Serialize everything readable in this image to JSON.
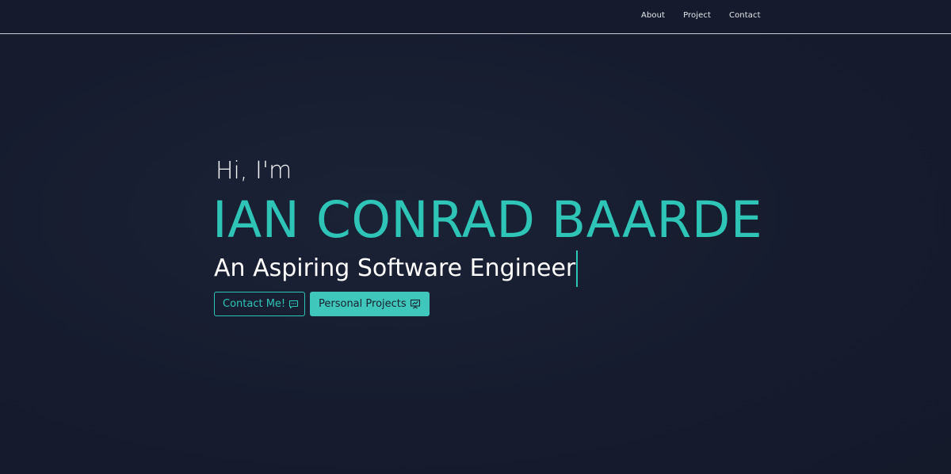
{
  "nav": {
    "items": [
      {
        "label": "About"
      },
      {
        "label": "Project"
      },
      {
        "label": "Contact"
      }
    ]
  },
  "hero": {
    "greeting": "Hi, I'm",
    "name": "IAN CONRAD BAARDE",
    "tagline": "An Aspiring Software Engineer",
    "contact_button": {
      "label": "Contact Me!",
      "icon": "chat-icon"
    },
    "projects_button": {
      "label": "Personal Projects",
      "icon": "presentation-icon"
    }
  },
  "colors": {
    "background": "#161c2e",
    "accent": "#2ec4b6",
    "text": "#ffffff"
  }
}
